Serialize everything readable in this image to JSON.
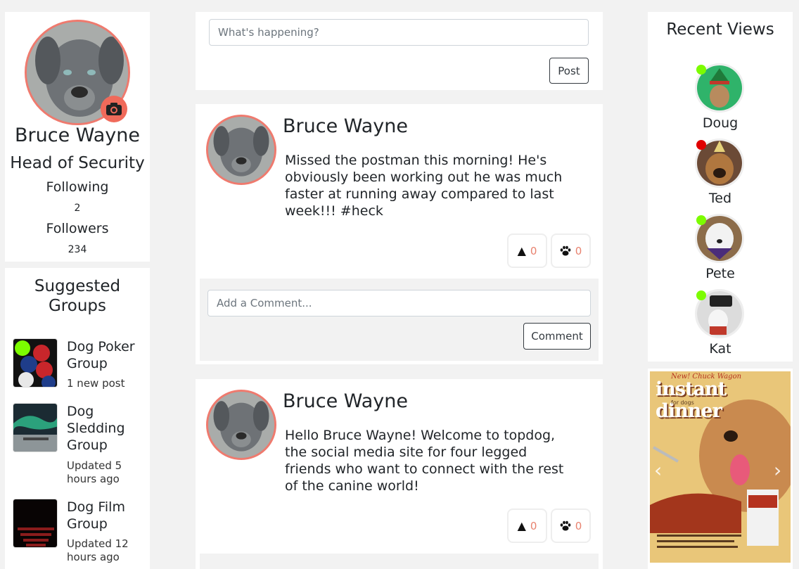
{
  "profile": {
    "name": "Bruce Wayne",
    "title": "Head of Security",
    "following_label": "Following",
    "following_count": "2",
    "followers_label": "Followers",
    "followers_count": "234"
  },
  "groups": {
    "title": "Suggested Groups",
    "items": [
      {
        "name": "Dog Poker Group",
        "meta": "1 new post"
      },
      {
        "name": "Dog Sledding Group",
        "meta": "Updated 5 hours ago"
      },
      {
        "name": "Dog Film Group",
        "meta": "Updated 12 hours ago"
      }
    ]
  },
  "compose": {
    "placeholder": "What's happening?",
    "post_label": "Post"
  },
  "posts": [
    {
      "author": "Bruce Wayne",
      "text": "Missed the postman this morning! He's obviously been working out he was much faster at running away compared to last week!!! #heck",
      "poop_count": "0",
      "paw_count": "0",
      "comment_placeholder": "Add a Comment...",
      "comment_label": "Comment"
    },
    {
      "author": "Bruce Wayne",
      "text": "Hello Bruce Wayne! Welcome to topdog, the social media site for four legged friends who want to connect with the rest of the canine world!",
      "poop_count": "0",
      "paw_count": "0"
    }
  ],
  "recent": {
    "title": "Recent Views",
    "items": [
      {
        "name": "Doug",
        "status_color": "#7cfc00"
      },
      {
        "name": "Ted",
        "status_color": "#e00000"
      },
      {
        "name": "Pete",
        "status_color": "#7cfc00"
      },
      {
        "name": "Kat",
        "status_color": "#7cfc00"
      }
    ]
  },
  "ad": {
    "tagline": "New! Chuck Wagon",
    "headline": "instant dinner",
    "sub": "for dogs",
    "prev_glyph": "‹",
    "next_glyph": "›"
  },
  "colors": {
    "accent": "#ef7a6e",
    "camera": "#f06a5a",
    "online": "#7cfc00",
    "offline": "#e00000"
  }
}
